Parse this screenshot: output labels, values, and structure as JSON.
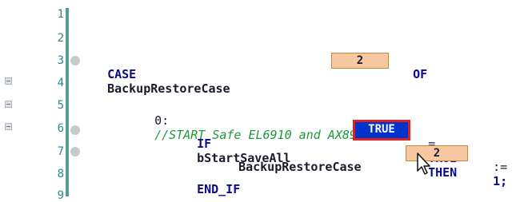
{
  "line_numbers": [
    "1",
    "2",
    "3",
    "4",
    "5",
    "6",
    "7",
    "8",
    "9"
  ],
  "code": {
    "line3": {
      "kw_case": "CASE",
      "ident": "BackupRestoreCase",
      "value": "2",
      "kw_of": "OF"
    },
    "line5": {
      "label": "0:",
      "comment": "//START Safe EL6910 and AX8911"
    },
    "line6": {
      "kw_if": "IF",
      "ident": "bStartSaveAll",
      "value": "TRUE",
      "op": "=",
      "lit": "TRUE",
      "kw_then": "THEN"
    },
    "line7": {
      "ident": "BackupRestoreCase",
      "value": "2",
      "assign": ":=",
      "num": "1;"
    },
    "line8": {
      "kw_end_if": "END_IF"
    }
  },
  "colors": {
    "gutter_separator": "#5a9a9a",
    "line_number": "#2a8a8a",
    "keyword": "#0a0a8a",
    "comment": "#1a9a3a",
    "watch_value_bg": "#f6c9a3",
    "true_highlight_bg": "#0033cc",
    "highlight_outline": "#e02020"
  },
  "icons": [
    "fold-collapse-icon",
    "breakpoint-marker-icon",
    "mouse-cursor-icon"
  ]
}
